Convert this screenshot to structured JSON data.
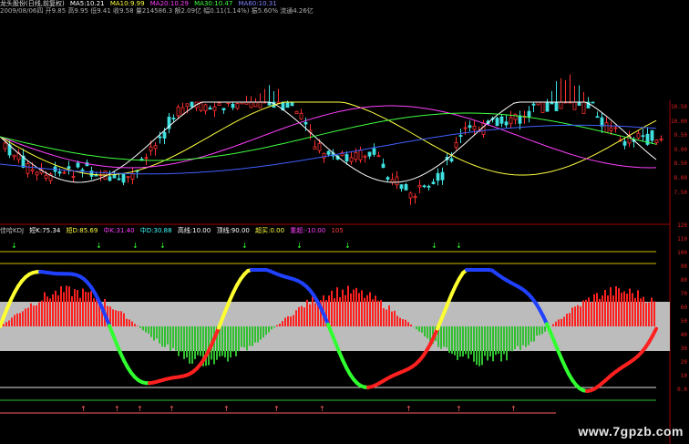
{
  "top_panel": {
    "title": "龙头股份(日线,前复权)",
    "ma5": "MA5:10.21",
    "ma10": "MA10:9.99",
    "ma20": "MA20:10.29",
    "ma30": "MA30:10.47",
    "ma60": "MA60:10.31",
    "date_line": "2009/08/06四 开9.85 高9.95 低9.41 收9.58 量214586.3 额2.09亿 幅0.11(1.14%) 振5.60% 流通4.26亿",
    "price_axis": [
      "10.50",
      "10.00",
      "9.50",
      "9.00",
      "8.50",
      "8.00",
      "7.50"
    ]
  },
  "bottom_panel": {
    "indicator": "佳哈KDJ",
    "k": "短K:75.34",
    "d": "短D:85.69",
    "mid": "中K:31.40",
    "midd": "中D:30.88",
    "high": "高线:10.00",
    "top": "顶线:90.00",
    "buy": "超买:0.00",
    "sell": "重超:-10.00",
    "tail": "105",
    "axis": [
      "120",
      "110",
      "100",
      "90",
      "80",
      "70",
      "60",
      "50",
      "40",
      "30",
      "20",
      "10",
      "0.0"
    ]
  },
  "watermark": "www.7gpzb.com",
  "colors": {
    "k_red": "#ff2020",
    "k_yellow": "#ffff30",
    "k_blue": "#2040ff",
    "k_green": "#30ff30",
    "band": "#bcbcbc"
  }
}
